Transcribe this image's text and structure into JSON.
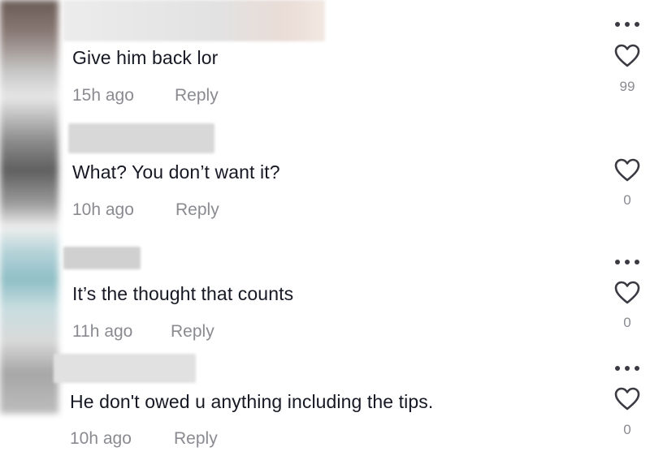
{
  "comments": [
    {
      "text": "Give him back lor",
      "time": "15h ago",
      "reply_label": "Reply",
      "likes": "99",
      "has_more": true
    },
    {
      "text": "What? You don’t want it?",
      "time": "10h ago",
      "reply_label": "Reply",
      "likes": "0",
      "has_more": false
    },
    {
      "text": "It’s the thought that counts",
      "time": "11h ago",
      "reply_label": "Reply",
      "likes": "0",
      "has_more": true
    },
    {
      "text": "He don't owed u anything including the tips.",
      "time": "10h ago",
      "reply_label": "Reply",
      "likes": "0",
      "has_more": true
    }
  ],
  "icons": {
    "more": "more-dots-icon",
    "like": "heart-outline-icon"
  },
  "colors": {
    "text_primary": "#161823",
    "text_secondary": "#8a8b91",
    "icon": "#3a3b42"
  }
}
